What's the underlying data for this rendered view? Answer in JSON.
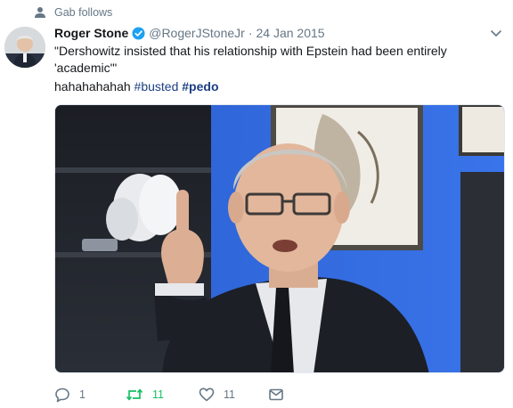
{
  "context": {
    "label": "Gab follows",
    "icon": "person-icon"
  },
  "author": {
    "display_name": "Roger Stone",
    "verified_icon": "verified-badge-icon",
    "handle": "@RogerJStoneJr",
    "separator": "·",
    "timestamp": "24 Jan 2015"
  },
  "tweet": {
    "text_line1": "\"Dershowitz insisted that his relationship with Epstein had been entirely",
    "text_line2": "'academic'\"",
    "prefix": "hahahahahah",
    "hashtag1": "#busted",
    "hashtag2": "#pedo"
  },
  "actions": {
    "reply_count": "1",
    "retweet_count": "11",
    "like_count": "11"
  },
  "colors": {
    "accent_link": "#1c3f82",
    "retweeted": "#17bf63",
    "verified": "#1da1f2",
    "muted": "#657786"
  }
}
